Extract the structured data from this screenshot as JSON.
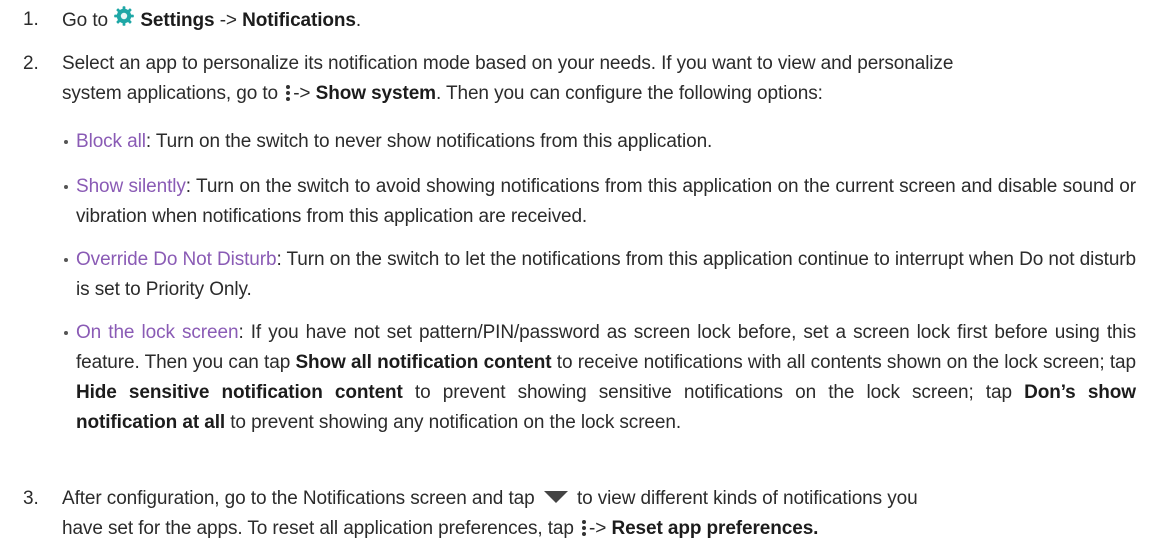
{
  "icons": {
    "settings": "settings-gear-icon",
    "overflow_menu": "more-vertical-icon",
    "expand": "triangle-down-icon"
  },
  "colors": {
    "term": "#8a5bb5",
    "text": "#2b2b2b",
    "settings_icon": "#1ea7a6"
  },
  "steps": [
    {
      "number": "1.",
      "lead": "Go to",
      "settings": "Settings",
      "arrow": "->",
      "notifications": "Notifications",
      "end": "."
    },
    {
      "number": "2.",
      "line1": "Select an app to personalize its notification mode based on your needs. If you want to view and personalize",
      "line2a": "system applications, go to",
      "line2_arrow": "->",
      "show_system": "Show system",
      "line2b": ". Then you can configure the following options:"
    },
    {
      "number": "3.",
      "line1a": "After configuration, go to the Notifications screen and tap",
      "line1b": "to view different kinds of notifications you",
      "line2a": "have set for the apps. To reset all application preferences, tap",
      "line2_arrow": "->",
      "reset": "Reset app preferences."
    }
  ],
  "options": [
    {
      "term": "Block all",
      "text": ": Turn on the switch to never show notifications from this application."
    },
    {
      "term": "Show silently",
      "text": ": Turn on the switch to avoid showing notifications from this application on the current screen and disable sound or vibration when notifications from this application are received."
    },
    {
      "term": "Override Do Not Disturb",
      "text": ": Turn on the switch to let the notifications from this application continue to interrupt when Do not disturb is set to Priority Only."
    },
    {
      "term": "On the lock screen",
      "t1": ": If you have not set pattern/PIN/password as screen lock before, set a screen lock first before using this feature. Then you can tap ",
      "b1": "Show all notification content",
      "t2": " to receive notifications with all contents shown on the lock screen; tap ",
      "b2": "Hide sensitive notification content",
      "t3": " to prevent showing sensitive notifications on the lock screen; tap ",
      "b3": "Don’s show notification at all",
      "t4": " to prevent showing any notification on the lock screen."
    }
  ]
}
